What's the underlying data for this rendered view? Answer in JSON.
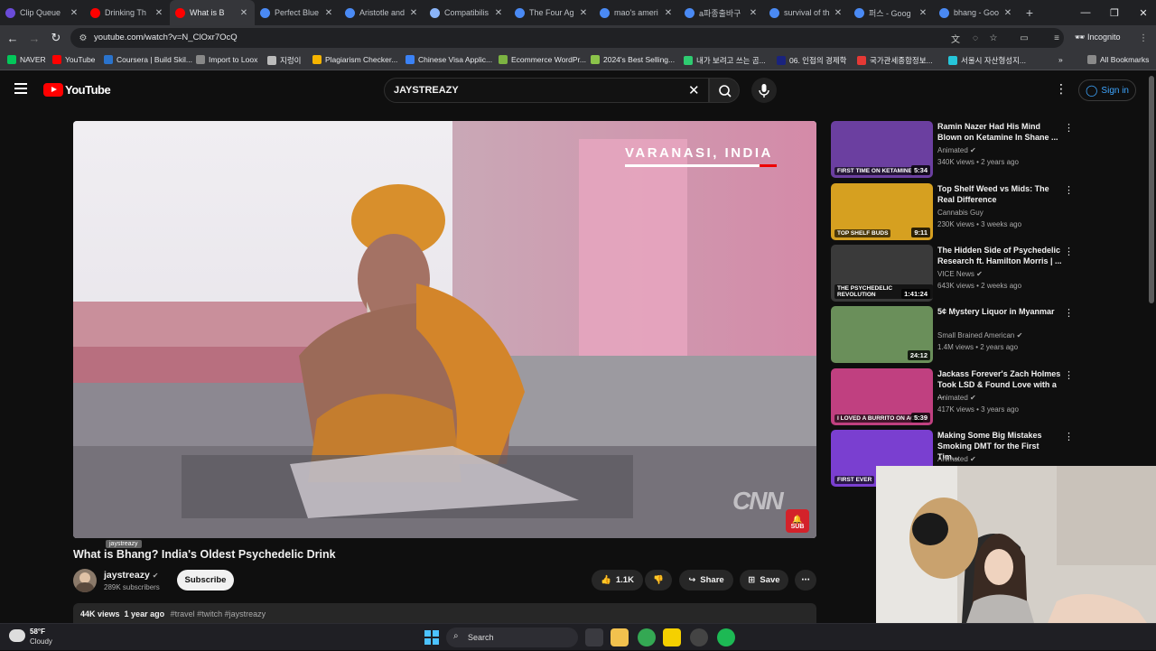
{
  "browser": {
    "tabs": [
      {
        "label": "Clip Queue",
        "color": "#6a4bd8",
        "active": false
      },
      {
        "label": "Drinking Th",
        "color": "#ff0000",
        "active": false
      },
      {
        "label": "What is B",
        "color": "#ff0000",
        "active": true
      },
      {
        "label": "Perfect Blue",
        "color": "#4a8af4",
        "active": false
      },
      {
        "label": "Aristotle and",
        "color": "#4a8af4",
        "active": false
      },
      {
        "label": "Compatibilis",
        "color": "#8ab4f8",
        "active": false
      },
      {
        "label": "The Four Ag",
        "color": "#4a8af4",
        "active": false
      },
      {
        "label": "mao's ameri",
        "color": "#4a8af4",
        "active": false
      },
      {
        "label": "a파종출바구",
        "color": "#4a8af4",
        "active": false
      },
      {
        "label": "survival of th",
        "color": "#4a8af4",
        "active": false
      },
      {
        "label": "퍼스 - Goog",
        "color": "#4a8af4",
        "active": false
      },
      {
        "label": "bhang - Goo",
        "color": "#4a8af4",
        "active": false
      }
    ],
    "new_tab_glyph": "+",
    "url": "youtube.com/watch?v=N_ClOxr7OcQ",
    "incognito_label": "Incognito",
    "bookmarks": [
      {
        "label": "NAVER",
        "color": "#03c75a"
      },
      {
        "label": "YouTube",
        "color": "#ff0000"
      },
      {
        "label": "Coursera | Build Skil...",
        "color": "#2a73cc"
      },
      {
        "label": "Import to Loox",
        "color": "#888888"
      },
      {
        "label": "지렁이",
        "color": "#bbbbbb"
      },
      {
        "label": "Plagiarism Checker...",
        "color": "#f5b400"
      },
      {
        "label": "Chinese Visa Applic...",
        "color": "#3b82f6"
      },
      {
        "label": "Ecommerce WordPr...",
        "color": "#7cb342"
      },
      {
        "label": "2024's Best Selling...",
        "color": "#8bc34a"
      },
      {
        "label": "내가 보려고 쓰는 곰...",
        "color": "#2ecc71"
      },
      {
        "label": "06. 인접의 경제학",
        "color": "#1a237e"
      },
      {
        "label": "국가관세종합정보...",
        "color": "#e53935"
      },
      {
        "label": "서울시 자산형성지...",
        "color": "#26c6da"
      }
    ],
    "all_bookmarks_label": "All Bookmarks"
  },
  "youtube": {
    "wordmark": "YouTube",
    "search_query": "JAYSTREAZY",
    "sign_in_label": "Sign in",
    "video": {
      "location_caption": "VARANASI, INDIA",
      "network_logo": "CNN",
      "sub_badge": "SUB",
      "title": "What is Bhang? India's Oldest Psychedelic Drink",
      "channel_tooltip": "jaystreazy",
      "channel_name": "jaystreazy",
      "subscribers": "289K subscribers",
      "subscribe_label": "Subscribe",
      "likes": "1.1K",
      "share_label": "Share",
      "save_label": "Save",
      "views": "44K views",
      "age": "1 year ago",
      "tags": "#travel #twitch #jaystreazy"
    },
    "recommendations": [
      {
        "title": "Ramin Nazer Had His Mind Blown on Ketamine In Shane ...",
        "channel": "Animated",
        "verified": true,
        "meta": "340K views • 2 years ago",
        "duration": "5:34",
        "caption": "FIRST TIME ON KETAMINE",
        "thumb_color": "#6b3fa0"
      },
      {
        "title": "Top Shelf Weed vs Mids: The Real Difference",
        "channel": "Cannabis Guy",
        "verified": false,
        "meta": "230K views • 3 weeks ago",
        "duration": "9:11",
        "caption": "TOP SHELF BUDS",
        "thumb_color": "#d6a020"
      },
      {
        "title": "The Hidden Side of Psychedelic Research ft. Hamilton Morris | ...",
        "channel": "VICE News",
        "verified": true,
        "meta": "643K views • 2 weeks ago",
        "duration": "1:41:24",
        "caption": "THE PSYCHEDELIC REVOLUTION",
        "thumb_color": "#3a3a3a"
      },
      {
        "title": "5¢ Mystery Liquor in Myanmar",
        "channel": "Small Brained American",
        "verified": true,
        "meta": "1.4M views • 2 years ago",
        "duration": "24:12",
        "caption": "",
        "thumb_color": "#6a8f5a"
      },
      {
        "title": "Jackass Forever's Zach Holmes Took LSD & Found Love with a ...",
        "channel": "Animated",
        "verified": true,
        "meta": "417K views • 3 years ago",
        "duration": "5:39",
        "caption": "I LOVED A BURRITO ON ACID",
        "thumb_color": "#c04080"
      },
      {
        "title": "Making Some Big Mistakes Smoking DMT for the First Tim...",
        "channel": "Animated",
        "verified": true,
        "meta": "",
        "duration": "",
        "caption": "FIRST EVER",
        "thumb_color": "#7a3fd0"
      }
    ]
  },
  "taskbar": {
    "weather_temp": "58°F",
    "weather_desc": "Cloudy",
    "search_label": "Search"
  },
  "colors": {
    "yt_red": "#ff0000",
    "link_blue": "#3ea6ff",
    "bg": "#0f0f0f"
  }
}
